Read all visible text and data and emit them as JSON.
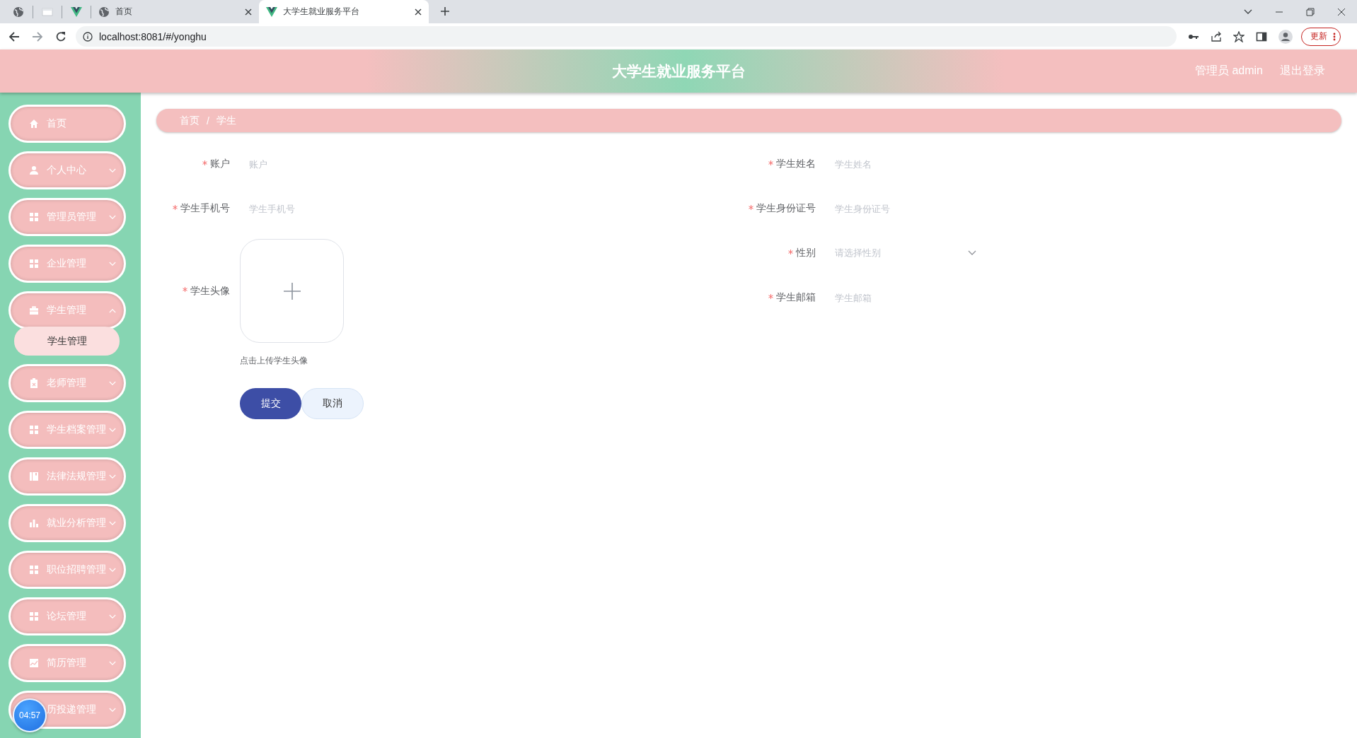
{
  "browser": {
    "tabs": [
      {
        "kind": "pinned",
        "selected": false
      },
      {
        "kind": "pinned",
        "selected": false
      },
      {
        "kind": "pinned",
        "selected": false
      },
      {
        "kind": "normal",
        "title": "首页",
        "selected": false
      },
      {
        "kind": "normal",
        "title": "大学生就业服务平台",
        "selected": true
      }
    ],
    "address": "localhost:8081/#/yonghu",
    "update_button": "更新"
  },
  "header": {
    "title": "大学生就业服务平台",
    "user": "管理员 admin",
    "logout": "退出登录"
  },
  "sidebar": {
    "items": [
      {
        "label": "首页"
      },
      {
        "label": "个人中心",
        "expanded": false
      },
      {
        "label": "管理员管理",
        "expanded": false
      },
      {
        "label": "企业管理",
        "expanded": false
      },
      {
        "label": "学生管理",
        "expanded": true,
        "children": [
          {
            "label": "学生管理",
            "selected": true
          }
        ]
      },
      {
        "label": "老师管理",
        "expanded": false
      },
      {
        "label": "学生档案管理",
        "expanded": false
      },
      {
        "label": "法律法规管理",
        "expanded": false
      },
      {
        "label": "就业分析管理",
        "expanded": false
      },
      {
        "label": "职位招聘管理",
        "expanded": false
      },
      {
        "label": "论坛管理",
        "expanded": false
      },
      {
        "label": "简历管理",
        "expanded": false
      },
      {
        "label": "历投递管理",
        "expanded": false
      }
    ]
  },
  "timer": "04:57",
  "breadcrumb": {
    "items": [
      "首页",
      "学生"
    ],
    "separator": "/"
  },
  "form": {
    "left_fields": [
      {
        "kind": "text",
        "label": "账户",
        "placeholder": "账户",
        "required": true
      },
      {
        "kind": "text",
        "label": "学生手机号",
        "placeholder": "学生手机号",
        "required": true
      },
      {
        "kind": "upload",
        "label": "学生头像",
        "hint": "点击上传学生头像",
        "required": true
      }
    ],
    "right_fields": [
      {
        "kind": "text",
        "label": "学生姓名",
        "placeholder": "学生姓名",
        "required": true
      },
      {
        "kind": "text",
        "label": "学生身份证号",
        "placeholder": "学生身份证号",
        "required": true
      },
      {
        "kind": "select",
        "label": "性别",
        "placeholder": "请选择性别",
        "required": true
      },
      {
        "kind": "text",
        "label": "学生邮箱",
        "placeholder": "学生邮箱",
        "required": true
      }
    ],
    "buttons": [
      {
        "kind": "primary",
        "label": "提交"
      },
      {
        "kind": "secondary",
        "label": "取消"
      }
    ]
  }
}
